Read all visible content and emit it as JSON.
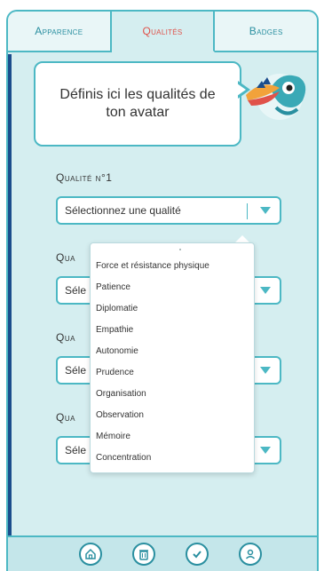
{
  "tabs": [
    {
      "label": "Apparence",
      "active": false
    },
    {
      "label": "Qualités",
      "active": true
    },
    {
      "label": "Badges",
      "active": false
    }
  ],
  "bubble": {
    "line1": "Définis ici les qualités de",
    "line2": "ton avatar"
  },
  "qualities": [
    {
      "label": "Qualité n°1",
      "select": "Sélectionnez une qualité"
    },
    {
      "label": "Qua",
      "select": "Séle"
    },
    {
      "label": "Qua",
      "select": "Séle"
    },
    {
      "label": "Qua",
      "select": "Séle"
    }
  ],
  "dropdown": {
    "options": [
      "Force et résistance physique",
      "Patience",
      "Diplomatie",
      "Empathie",
      "Autonomie",
      "Prudence",
      "Organisation",
      "Observation",
      "Mémoire",
      "Concentration"
    ]
  },
  "bottom_icons": [
    "home-icon",
    "trash-icon",
    "check-icon",
    "profile-icon"
  ],
  "colors": {
    "accent": "#4cb8c4",
    "active_tab_text": "#e0524a",
    "background": "#d5eef0",
    "left_edge": "#1b4d8c"
  }
}
